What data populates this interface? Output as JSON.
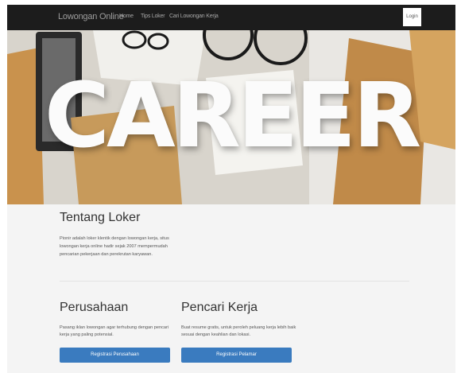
{
  "navbar": {
    "brand": "Lowongan Online",
    "links": [
      "Home",
      "Tips Loker",
      "Cari Lowongan Kerja"
    ],
    "login_label": "Login"
  },
  "hero": {
    "title": "CAREER"
  },
  "about": {
    "title": "Tentang Loker",
    "text": "Pionir adalah loker klentik dengan lowongan kerja, situs lowongan kerja online hadir sejak 2007 mempermudah pencarian pekerjaan dan perekrutan karyawan."
  },
  "company": {
    "title": "Perusahaan",
    "text": "Pasang iklan lowongan agar terhubung dengan pencari kerja yang paling potensial.",
    "button_label": "Registrasi Perusahaan"
  },
  "jobseeker": {
    "title": "Pencari Kerja",
    "text": "Buat resume gratis, untuk peroleh peluang kerja lebih baik sesuai dengan keahlian dan lokasi.",
    "button_label": "Registrasi Pelamar"
  },
  "colors": {
    "navbar_bg": "#1c1c1c",
    "button_primary": "#3a7bbf",
    "content_bg": "#f4f4f4"
  }
}
